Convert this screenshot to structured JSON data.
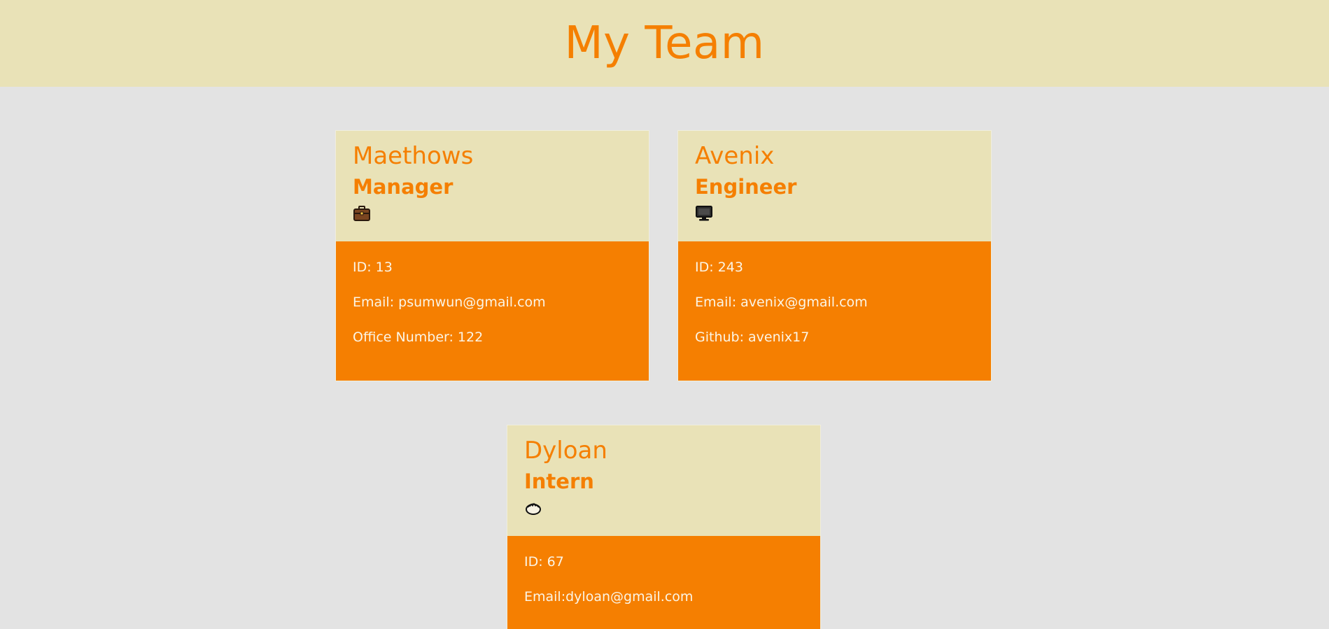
{
  "page_title": "My Team",
  "team": [
    {
      "name": "Maethows",
      "role": "Manager",
      "icon": "briefcase-icon",
      "id_text": "ID: 13",
      "email_text": "Email: psumwun@gmail.com",
      "extra_text": "Office Number: 122"
    },
    {
      "name": "Avenix",
      "role": "Engineer",
      "icon": "computer-icon",
      "id_text": "ID: 243",
      "email_text": "Email: avenix@gmail.com",
      "extra_text": "Github: avenix17"
    },
    {
      "name": "Dyloan",
      "role": "Intern",
      "icon": "graduation-icon",
      "id_text": "ID: 67",
      "email_text": "Email:dyloan@gmail.com",
      "extra_text": ""
    }
  ],
  "colors": {
    "accent": "#f57f01",
    "header_bg": "#e9e2b7",
    "page_bg": "#e3e3e3",
    "body_text": "#fbf5e6"
  }
}
